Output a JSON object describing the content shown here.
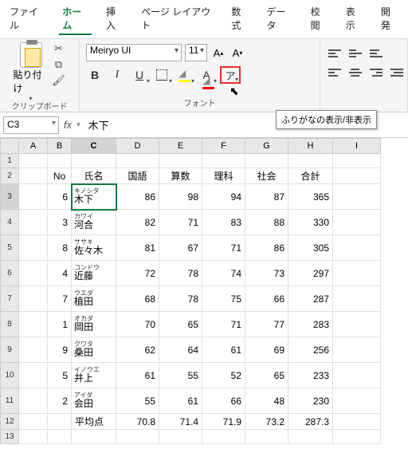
{
  "menu": [
    "ファイル",
    "ホーム",
    "挿入",
    "ページ レイアウト",
    "数式",
    "データ",
    "校閲",
    "表示",
    "開発"
  ],
  "menu_active": 1,
  "clipboard": {
    "paste": "貼り付け",
    "label": "クリップボード"
  },
  "font": {
    "name": "Meiryo UI",
    "size": "11",
    "label": "フォント",
    "bold": "B",
    "italic": "I",
    "underline": "U",
    "furigana": "ア",
    "fcolor": "A"
  },
  "tooltip": "ふりがなの表示/非表示",
  "namebox": "C3",
  "formula_value": "木下",
  "columns": [
    "A",
    "B",
    "C",
    "D",
    "E",
    "F",
    "G",
    "H",
    "I"
  ],
  "col_sel": 2,
  "row_sel": 2,
  "headers": {
    "no": "No",
    "name": "氏名",
    "kokugo": "国語",
    "sansu": "算数",
    "rika": "理科",
    "shakai": "社会",
    "gokei": "合計"
  },
  "rows": [
    {
      "no": 6,
      "furi": "キノシタ",
      "name": "木下",
      "v": [
        86,
        98,
        94,
        87,
        365
      ]
    },
    {
      "no": 3,
      "furi": "カワイ",
      "name": "河合",
      "v": [
        82,
        71,
        83,
        88,
        330
      ]
    },
    {
      "no": 8,
      "furi": "ササキ",
      "name": "佐々木",
      "v": [
        81,
        67,
        71,
        86,
        305
      ]
    },
    {
      "no": 4,
      "furi": "コンドウ",
      "name": "近藤",
      "v": [
        72,
        78,
        74,
        73,
        297
      ]
    },
    {
      "no": 7,
      "furi": "ウエダ",
      "name": "植田",
      "v": [
        68,
        78,
        75,
        66,
        287
      ]
    },
    {
      "no": 1,
      "furi": "オカダ",
      "name": "岡田",
      "v": [
        70,
        65,
        71,
        77,
        283
      ]
    },
    {
      "no": 9,
      "furi": "クワタ",
      "name": "桑田",
      "v": [
        62,
        64,
        61,
        69,
        256
      ]
    },
    {
      "no": 5,
      "furi": "イノウエ",
      "name": "井上",
      "v": [
        61,
        55,
        52,
        65,
        233
      ]
    },
    {
      "no": 2,
      "furi": "アイダ",
      "name": "会田",
      "v": [
        55,
        61,
        66,
        48,
        230
      ]
    }
  ],
  "avg": {
    "label": "平均点",
    "v": [
      70.8,
      71.4,
      71.9,
      73.2,
      287.3
    ]
  },
  "chart_data": {
    "type": "table",
    "columns": [
      "No",
      "氏名",
      "国語",
      "算数",
      "理科",
      "社会",
      "合計"
    ],
    "rows": [
      [
        6,
        "木下",
        86,
        98,
        94,
        87,
        365
      ],
      [
        3,
        "河合",
        82,
        71,
        83,
        88,
        330
      ],
      [
        8,
        "佐々木",
        81,
        67,
        71,
        86,
        305
      ],
      [
        4,
        "近藤",
        72,
        78,
        74,
        73,
        297
      ],
      [
        7,
        "植田",
        68,
        78,
        75,
        66,
        287
      ],
      [
        1,
        "岡田",
        70,
        65,
        71,
        77,
        283
      ],
      [
        9,
        "桑田",
        62,
        64,
        61,
        69,
        256
      ],
      [
        5,
        "井上",
        61,
        55,
        52,
        65,
        233
      ],
      [
        2,
        "会田",
        55,
        61,
        66,
        48,
        230
      ],
      [
        "",
        "平均点",
        70.8,
        71.4,
        71.9,
        73.2,
        287.3
      ]
    ]
  }
}
